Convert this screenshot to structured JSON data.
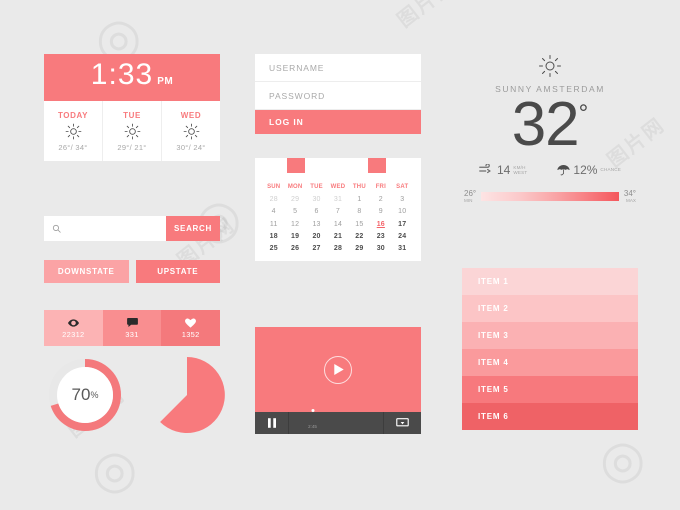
{
  "clock_widget": {
    "time": "1:33",
    "ampm": "PM",
    "forecast": [
      {
        "day": "TODAY",
        "icon": "sun-icon",
        "temps": "26°/ 34°"
      },
      {
        "day": "TUE",
        "icon": "sun-icon",
        "temps": "29°/ 21°"
      },
      {
        "day": "WED",
        "icon": "sun-icon",
        "temps": "30°/ 24°"
      }
    ]
  },
  "search": {
    "icon": "search-icon",
    "value": "",
    "placeholder": "",
    "button_label": "SEARCH"
  },
  "state_buttons": {
    "down_label": "DOWNSTATE",
    "up_label": "UPSTATE"
  },
  "stats": [
    {
      "icon": "eye-icon",
      "value": "22312"
    },
    {
      "icon": "comment-icon",
      "value": "331"
    },
    {
      "icon": "heart-icon",
      "value": "1352"
    }
  ],
  "donut": {
    "value": 70,
    "label": "70",
    "suffix": "%",
    "track_color": "#ffffff",
    "fill_color": "#f4797c"
  },
  "pie": {
    "value": 70,
    "fill_color": "#f87a7d"
  },
  "login": {
    "username_placeholder": "USERNAME",
    "password_placeholder": "PASSWORD",
    "username_value": "",
    "password_value": "",
    "submit_label": "LOG IN"
  },
  "calendar": {
    "prev_tab": "prev-month-tab",
    "next_tab": "next-month-tab",
    "weekdays": [
      "SUN",
      "MON",
      "TUE",
      "WED",
      "THU",
      "FRI",
      "SAT"
    ],
    "today": "16",
    "weeks": [
      [
        {
          "d": "28",
          "s": "muted"
        },
        {
          "d": "29",
          "s": "muted"
        },
        {
          "d": "30",
          "s": "muted"
        },
        {
          "d": "31",
          "s": "muted"
        },
        {
          "d": "1",
          "s": "normal"
        },
        {
          "d": "2",
          "s": "normal"
        },
        {
          "d": "3",
          "s": "normal"
        }
      ],
      [
        {
          "d": "4",
          "s": "normal"
        },
        {
          "d": "5",
          "s": "normal"
        },
        {
          "d": "6",
          "s": "normal"
        },
        {
          "d": "7",
          "s": "normal"
        },
        {
          "d": "8",
          "s": "normal"
        },
        {
          "d": "9",
          "s": "normal"
        },
        {
          "d": "10",
          "s": "normal"
        }
      ],
      [
        {
          "d": "11",
          "s": "normal"
        },
        {
          "d": "12",
          "s": "normal"
        },
        {
          "d": "13",
          "s": "normal"
        },
        {
          "d": "14",
          "s": "normal"
        },
        {
          "d": "15",
          "s": "normal"
        },
        {
          "d": "16",
          "s": "today"
        },
        {
          "d": "17",
          "s": "bold"
        }
      ],
      [
        {
          "d": "18",
          "s": "bold"
        },
        {
          "d": "19",
          "s": "bold"
        },
        {
          "d": "20",
          "s": "bold"
        },
        {
          "d": "21",
          "s": "bold"
        },
        {
          "d": "22",
          "s": "bold"
        },
        {
          "d": "23",
          "s": "bold"
        },
        {
          "d": "24",
          "s": "bold"
        }
      ],
      [
        {
          "d": "25",
          "s": "bold"
        },
        {
          "d": "26",
          "s": "bold"
        },
        {
          "d": "27",
          "s": "bold"
        },
        {
          "d": "28",
          "s": "bold"
        },
        {
          "d": "29",
          "s": "bold"
        },
        {
          "d": "30",
          "s": "bold"
        },
        {
          "d": "31",
          "s": "bold"
        }
      ]
    ]
  },
  "video": {
    "play_icon": "play-icon",
    "pause_icon": "pause-icon",
    "fullscreen_icon": "fullscreen-icon",
    "progress_percent": 25,
    "time_label": "2:45"
  },
  "weather": {
    "condition_icon": "sun-icon",
    "location": "SUNNY AMSTERDAM",
    "temperature": "32",
    "degree": "°",
    "wind": {
      "icon": "wind-icon",
      "value": "14",
      "unit_line1": "KM/H",
      "unit_line2": "WEST"
    },
    "rain": {
      "icon": "umbrella-icon",
      "value": "12%",
      "unit_line1": "CHANCE",
      "unit_line2": ""
    },
    "range": {
      "min_temp": "26°",
      "min_label": "MIN",
      "max_temp": "34°",
      "max_label": "MAX"
    }
  },
  "item_list": [
    {
      "label": "ITEM 1"
    },
    {
      "label": "ITEM 2"
    },
    {
      "label": "ITEM 3"
    },
    {
      "label": "ITEM 4"
    },
    {
      "label": "ITEM 5"
    },
    {
      "label": "ITEM 6"
    }
  ],
  "theme": {
    "background": "#eaeaea",
    "accent": "#f87a7d",
    "accent_dark": "#ef6266",
    "accent_light": "#fbd5d6",
    "white": "#ffffff",
    "control_dark": "#4a4a4a"
  }
}
